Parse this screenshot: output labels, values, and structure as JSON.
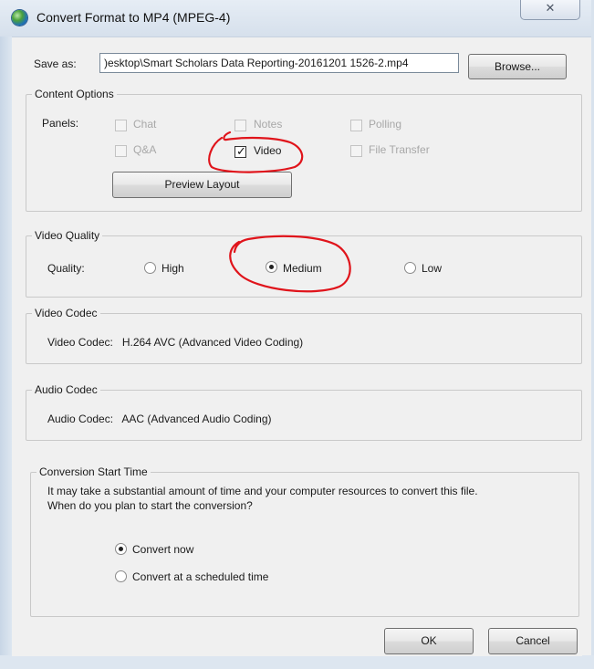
{
  "window": {
    "title": "Convert Format to MP4 (MPEG-4)",
    "close_symbol": "✕"
  },
  "save_as": {
    "label": "Save as:",
    "value": ")esktop\\Smart Scholars Data Reporting-20161201 1526-2.mp4",
    "browse_label": "Browse..."
  },
  "content_options": {
    "legend": "Content Options",
    "panels_label": "Panels:",
    "panels": [
      {
        "label": "Chat",
        "checked": false,
        "enabled": false
      },
      {
        "label": "Notes",
        "checked": false,
        "enabled": false
      },
      {
        "label": "Polling",
        "checked": false,
        "enabled": false
      },
      {
        "label": "Q&A",
        "checked": false,
        "enabled": false
      },
      {
        "label": "Video",
        "checked": true,
        "enabled": true
      },
      {
        "label": "File Transfer",
        "checked": false,
        "enabled": false
      }
    ],
    "preview_label": "Preview Layout"
  },
  "video_quality": {
    "legend": "Video Quality",
    "label": "Quality:",
    "options": [
      {
        "label": "High",
        "selected": false
      },
      {
        "label": "Medium",
        "selected": true
      },
      {
        "label": "Low",
        "selected": false
      }
    ]
  },
  "video_codec": {
    "legend": "Video Codec",
    "text": "Video Codec:   H.264 AVC (Advanced Video Coding)"
  },
  "audio_codec": {
    "legend": "Audio Codec",
    "text": "Audio Codec:   AAC (Advanced Audio Coding)"
  },
  "conversion": {
    "legend": "Conversion Start Time",
    "message_line1": "It may take a substantial amount of time and your computer resources to convert this file.",
    "message_line2": "When do you plan to start the conversion?",
    "options": [
      {
        "label": "Convert now",
        "selected": true
      },
      {
        "label": "Convert at a scheduled time",
        "selected": false
      }
    ]
  },
  "buttons": {
    "ok": "OK",
    "cancel": "Cancel"
  },
  "colors": {
    "annotation": "#e0141b",
    "title_bar": "#d6e0ec",
    "dialog_bg": "#f0f0f0"
  }
}
